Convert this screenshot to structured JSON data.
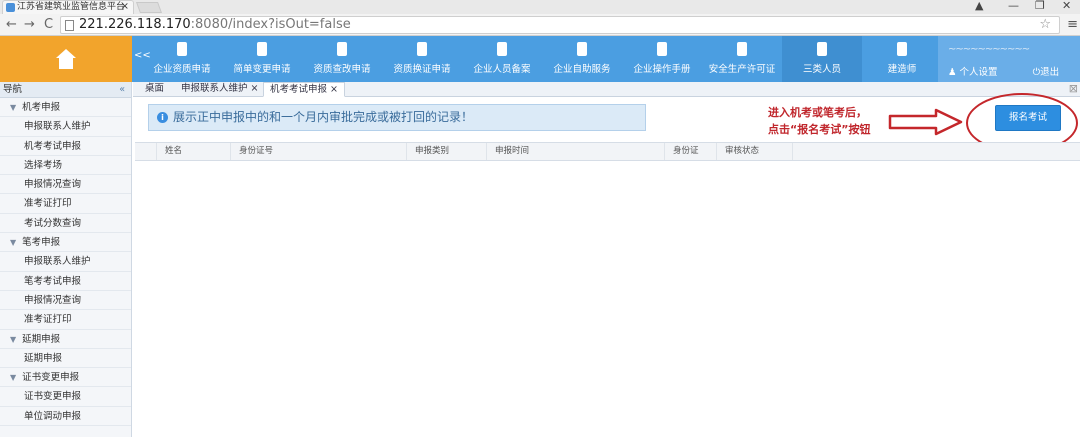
{
  "browser": {
    "tab_title": "江苏省建筑业监管信息平台",
    "tab_close": "×",
    "url_host": "221.226.118.170",
    "url_path": ":8080/index?isOut=false",
    "back": "←",
    "forward": "→",
    "reload": "C",
    "star": "☆",
    "menu": "≡"
  },
  "header": {
    "collapse": "<<",
    "nav": [
      {
        "label": "企业资质申请"
      },
      {
        "label": "简单变更申请"
      },
      {
        "label": "资质查改申请"
      },
      {
        "label": "资质换证申请"
      },
      {
        "label": "企业人员备案"
      },
      {
        "label": "企业自助服务"
      },
      {
        "label": "企业操作手册"
      },
      {
        "label": "安全生产许可证"
      },
      {
        "label": "三类人员"
      },
      {
        "label": "建造师"
      }
    ],
    "user": {
      "name": "~~~~~~~~~~~",
      "settings": "个人设置",
      "logout": "退出"
    }
  },
  "sidebar": {
    "title": "导航",
    "collapse": "«",
    "groups": [
      {
        "label": "机考申报",
        "items": [
          "申报联系人维护",
          "机考考试申报",
          "选择考场",
          "申报情况查询",
          "准考证打印",
          "考试分数查询"
        ]
      },
      {
        "label": "笔考申报",
        "items": [
          "申报联系人维护",
          "笔考考试申报",
          "申报情况查询",
          "准考证打印"
        ]
      },
      {
        "label": "延期申报",
        "items": [
          "延期申报"
        ]
      },
      {
        "label": "证书变更申报",
        "items": [
          "证书变更申报",
          "单位调动申报"
        ]
      }
    ]
  },
  "tabs": [
    {
      "label": "桌面"
    },
    {
      "label": "申报联系人维护 ×"
    },
    {
      "label": "机考考试申报 ×"
    }
  ],
  "notice": "展示正中申报中的和一个月内审批完成或被打回的记录！",
  "annotation": {
    "line1": "进入机考或笔考后，",
    "line2": "点击“报名考试”按钮"
  },
  "button_exam": "报名考试",
  "table": {
    "columns": [
      "姓名",
      "身份证号",
      "申报类别",
      "申报时间",
      "身份证",
      "审核状态"
    ]
  }
}
